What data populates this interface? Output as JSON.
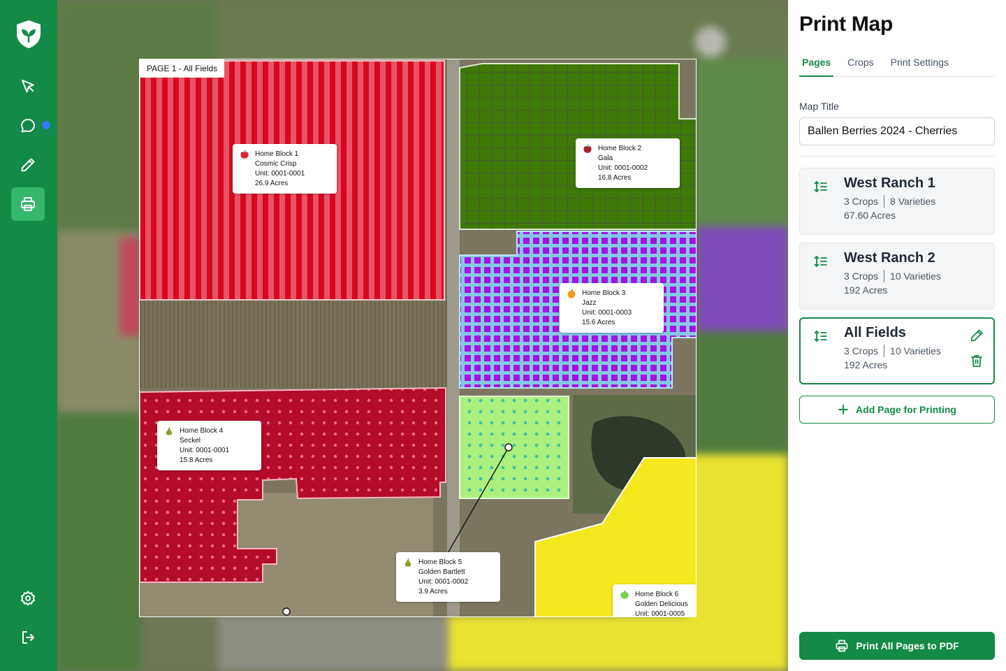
{
  "sidebar": {
    "items": [
      {
        "name": "select-tool",
        "icon": "cursor-icon"
      },
      {
        "name": "messages",
        "icon": "chat-icon",
        "has_notification": true
      },
      {
        "name": "draw-tool",
        "icon": "pencil-icon"
      },
      {
        "name": "print",
        "icon": "printer-icon",
        "active": true
      },
      {
        "name": "settings",
        "icon": "gear-icon"
      },
      {
        "name": "logout",
        "icon": "logout-icon"
      }
    ]
  },
  "map": {
    "page_label": "PAGE 1 - All Fields",
    "blocks": [
      {
        "name": "Home Block 1",
        "variety": "Cosmic Crisp",
        "unit": "Unit: 0001-0001",
        "acres": "26.9 Acres",
        "fruit": "apple-red",
        "color": "#d8071f"
      },
      {
        "name": "Home Block 2",
        "variety": "Gala",
        "unit": "Unit: 0001-0002",
        "acres": "16.8 Acres",
        "fruit": "apple-dark-red",
        "color": "#3e7a07"
      },
      {
        "name": "Home Block 3",
        "variety": "Jazz",
        "unit": "Unit: 0001-0003",
        "acres": "15.6 Acres",
        "fruit": "orange",
        "color": "#a21be0"
      },
      {
        "name": "Home Block 4",
        "variety": "Seckel",
        "unit": "Unit: 0001-0001",
        "acres": "15.8 Acres",
        "fruit": "pear",
        "color": "#b50b2a"
      },
      {
        "name": "Home Block 5",
        "variety": "Golden Bartlett",
        "unit": "Unit: 0001-0002",
        "acres": "3.9 Acres",
        "fruit": "pear",
        "color": "#9ee86a"
      },
      {
        "name": "Home Block 6",
        "variety": "Golden Delicious",
        "unit": "Unit: 0001-0005",
        "acres": "",
        "fruit": "apple-green",
        "color": "#f6e81f"
      }
    ]
  },
  "panel": {
    "title": "Print Map",
    "tabs": [
      {
        "label": "Pages",
        "active": true
      },
      {
        "label": "Crops",
        "active": false
      },
      {
        "label": "Print Settings",
        "active": false
      }
    ],
    "map_title_label": "Map Title",
    "map_title_value": "Ballen Berries 2024 - Cherries",
    "pages": [
      {
        "title": "West Ranch 1",
        "crops": "3 Crops",
        "varieties": "8 Varieties",
        "acres": "67.60 Acres",
        "selected": false
      },
      {
        "title": "West Ranch 2",
        "crops": "3 Crops",
        "varieties": "10 Varieties",
        "acres": "192 Acres",
        "selected": false
      },
      {
        "title": "All Fields",
        "crops": "3 Crops",
        "varieties": "10 Varieties",
        "acres": "192 Acres",
        "selected": true
      }
    ],
    "add_page_label": "Add Page for Printing",
    "print_all_label": "Print All Pages to PDF"
  },
  "colors": {
    "brand": "#138a47",
    "brand_active": "#35b76c",
    "notification": "#2f7cf6"
  }
}
